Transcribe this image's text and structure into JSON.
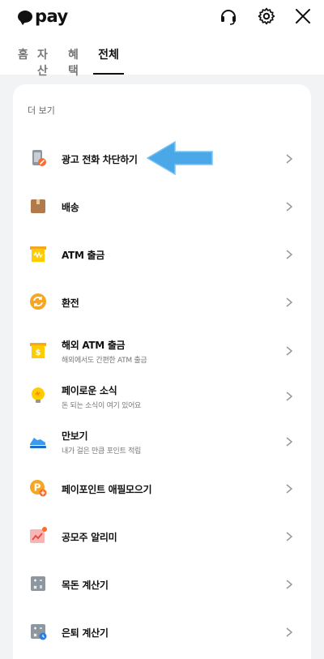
{
  "app": {
    "logo_text": "pay"
  },
  "header": {
    "icons": [
      "headset-icon",
      "gear-icon",
      "close-icon"
    ]
  },
  "tabs": [
    {
      "label": "홈",
      "active": false
    },
    {
      "label": "자산",
      "active": false
    },
    {
      "label": "혜택",
      "active": false
    },
    {
      "label": "전체",
      "active": true
    }
  ],
  "section": {
    "title": "더 보기"
  },
  "items": [
    {
      "title": "광고 전화 차단하기",
      "subtitle": "",
      "icon": "phone-block-icon"
    },
    {
      "title": "배송",
      "subtitle": "",
      "icon": "box-icon"
    },
    {
      "title": "ATM 출금",
      "subtitle": "",
      "icon": "atm-icon"
    },
    {
      "title": "환전",
      "subtitle": "",
      "icon": "exchange-icon"
    },
    {
      "title": "해외 ATM 출금",
      "subtitle": "해외에서도 간편한 ATM 출금",
      "icon": "overseas-atm-icon"
    },
    {
      "title": "페이로운 소식",
      "subtitle": "돈 되는 소식이 여기 있어요",
      "icon": "bulb-icon"
    },
    {
      "title": "만보기",
      "subtitle": "내가 걸은 만큼 포인트 적립",
      "icon": "sneaker-icon"
    },
    {
      "title": "페이포인트 애필모으기",
      "subtitle": "",
      "icon": "point-icon"
    },
    {
      "title": "공모주 알리미",
      "subtitle": "",
      "icon": "stock-alarm-icon"
    },
    {
      "title": "목돈 계산기",
      "subtitle": "",
      "icon": "calculator-icon"
    },
    {
      "title": "은퇴 계산기",
      "subtitle": "",
      "icon": "retire-calculator-icon"
    }
  ],
  "colors": {
    "accent_arrow": "#4aa8e8",
    "orange": "#f5a623",
    "yellow": "#ffcc00"
  }
}
